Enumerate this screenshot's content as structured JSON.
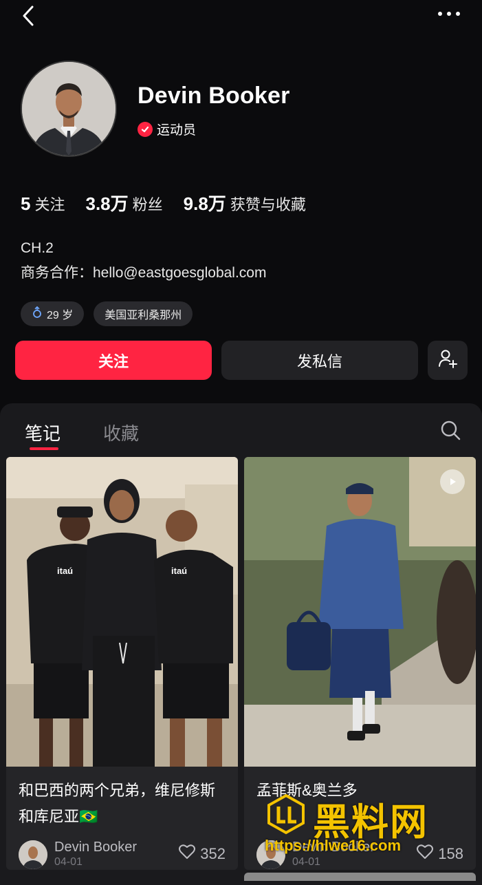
{
  "topbar": {
    "back_icon": "chevron-left-icon",
    "more_icon": "more-dots-icon"
  },
  "profile": {
    "name": "Devin Booker",
    "verified_label": "运动员",
    "stats": [
      {
        "value": "5",
        "label": "关注"
      },
      {
        "value": "3.8万",
        "label": "粉丝"
      },
      {
        "value": "9.8万",
        "label": "获赞与收藏"
      }
    ],
    "bio_line1": "CH.2",
    "bio_line2": "商务合作：hello@eastgoesglobal.com",
    "tags": [
      {
        "icon": "male-icon",
        "label": "29 岁"
      },
      {
        "label": "美国亚利桑那州"
      }
    ]
  },
  "actions": {
    "follow": "关注",
    "message": "发私信",
    "add_user_icon": "add-user-icon"
  },
  "tabs": {
    "notes": "笔记",
    "favorites": "收藏",
    "search_icon": "search-icon"
  },
  "cards": [
    {
      "title": "和巴西的两个兄弟，维尼修斯和库尼亚🇧🇷",
      "author": "Devin Booker",
      "date": "04-01",
      "likes": "352"
    },
    {
      "title": "孟菲斯&奥兰多",
      "author": "Devin Booker",
      "date": "04-01",
      "likes": "158",
      "has_video": true
    }
  ],
  "watermark": {
    "text": "黑料网",
    "url": "https://hlwe16.com"
  },
  "colors": {
    "accent": "#ff2442",
    "background": "#0b0b0d",
    "panel": "#1a1a1d"
  }
}
